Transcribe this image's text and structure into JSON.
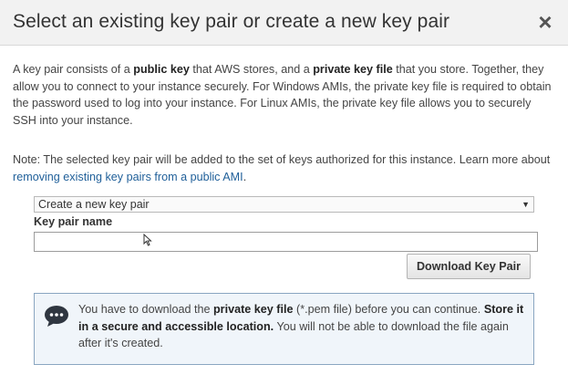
{
  "dialog": {
    "title": "Select an existing key pair or create a new key pair",
    "close_glyph": "×"
  },
  "intro": {
    "t1": "A key pair consists of a ",
    "b1": "public key",
    "t2": " that AWS stores, and a ",
    "b2": "private key file",
    "t3": " that you store. Together, they allow you to connect to your instance securely. For Windows AMIs, the private key file is required to obtain the password used to log into your instance. For Linux AMIs, the private key file allows you to securely SSH into your instance."
  },
  "note": {
    "text": "Note: The selected key pair will be added to the set of keys authorized for this instance. Learn more about ",
    "link": "removing existing key pairs from a public AMI",
    "end": "."
  },
  "key_pair_select": {
    "selected": "Create a new key pair",
    "arrow_glyph": "▼"
  },
  "key_pair_name": {
    "label": "Key pair name",
    "value": ""
  },
  "download_button": {
    "label": "Download Key Pair"
  },
  "info": {
    "icon": "speech-bubble-icon",
    "t1": "You have to download the ",
    "b1": "private key file",
    "t2": " (*.pem file) before you can continue. ",
    "b2": "Store it in a secure and accessible location.",
    "t3": " You will not be able to download the file again after it's created."
  }
}
